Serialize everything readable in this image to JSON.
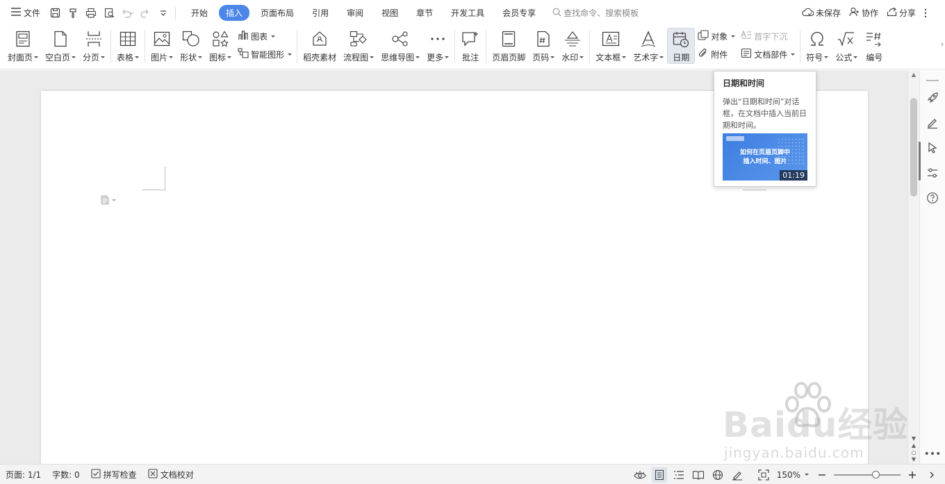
{
  "topbar": {
    "file_label": "文件",
    "menus": [
      "开始",
      "插入",
      "页面布局",
      "引用",
      "审阅",
      "视图",
      "章节",
      "开发工具",
      "会员专享"
    ],
    "active_menu_index": 1,
    "search_placeholder": "查找命令、搜索模板",
    "unsaved_label": "未保存",
    "collab_label": "协作",
    "share_label": "分享"
  },
  "ribbon": {
    "cover": "封面页",
    "blank_page": "空白页",
    "page_break": "分页",
    "table": "表格",
    "picture": "图片",
    "shape": "形状",
    "icon": "图标",
    "chart": "图表",
    "smart_graphic": "智能图形",
    "daoke": "稻壳素材",
    "flowchart": "流程图",
    "mindmap": "思维导图",
    "more": "更多",
    "comment": "批注",
    "header_footer": "页眉页脚",
    "page_number": "页码",
    "watermark": "水印",
    "textbox": "文本框",
    "wordart": "艺术字",
    "date": "日期",
    "object": "对象",
    "attachment": "附件",
    "drop_cap": "首字下沉",
    "doc_parts": "文档部件",
    "symbol": "符号",
    "formula": "公式",
    "numbering": "编号"
  },
  "tooltip": {
    "title": "日期和时间",
    "desc": "弹出“日期和时间”对话框，在文档中插入当前日期和时间。",
    "video_title_1": "如何在页眉页脚中",
    "video_title_2": "插入时间、图片",
    "video_duration": "01:19"
  },
  "watermark": {
    "brand": "Baidu经验",
    "url": "jingyan.baidu.com"
  },
  "statusbar": {
    "page": "页面: 1/1",
    "words": "字数: 0",
    "spellcheck": "拼写检查",
    "proofread": "文档校对",
    "zoom": "150%",
    "zoom_fraction": 0.62
  },
  "colors": {
    "accent": "#4b86e8",
    "icon": "#444444"
  }
}
